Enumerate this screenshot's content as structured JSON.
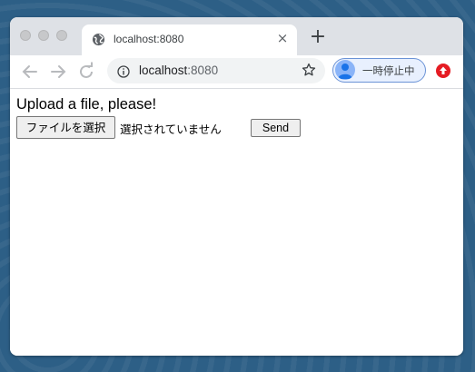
{
  "browser": {
    "tab": {
      "title": "localhost:8080",
      "close_glyph": "×",
      "icon": "globe-icon"
    },
    "new_tab_glyph": "+",
    "toolbar": {
      "back_icon": "back-arrow-icon",
      "forward_icon": "forward-arrow-icon",
      "reload_icon": "reload-icon",
      "url_host": "localhost",
      "url_port": ":8080",
      "bookmark_icon": "star-icon",
      "profile_label": "一時停止中",
      "extension_icon": "extension-icon"
    }
  },
  "page": {
    "heading": "Upload a file, please!",
    "file_button_label": "ファイルを選択",
    "file_status": "選択されていません",
    "send_label": "Send"
  },
  "colors": {
    "tabbar_bg": "#dee1e6",
    "omnibox_bg": "#f1f3f4",
    "profile_border": "#6b93d6",
    "extension_red": "#e51c23",
    "desktop_bg": "#2d5f86"
  }
}
